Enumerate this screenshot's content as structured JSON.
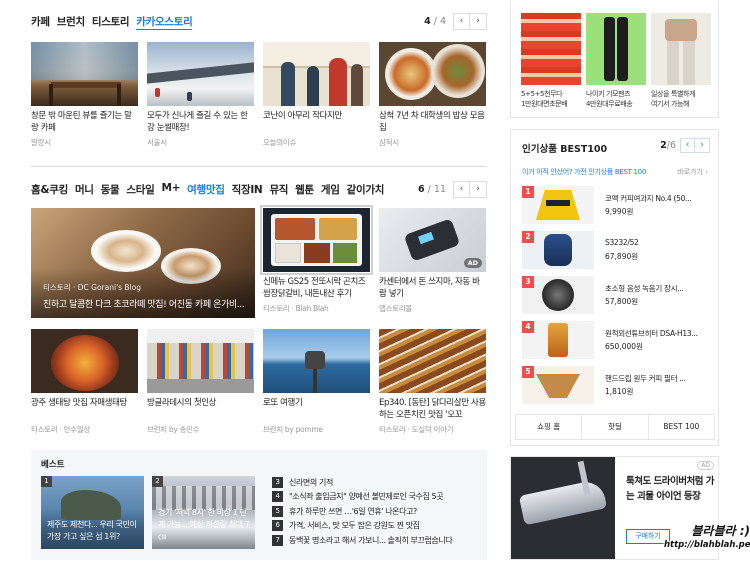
{
  "section1": {
    "tabs": [
      "카페",
      "브런치",
      "티스토리",
      "카카오스토리"
    ],
    "active_index": 3,
    "pager": {
      "current": "4",
      "total": "4"
    },
    "cards": [
      {
        "title": "창문 밖 마운틴 뷰를 즐기는 말랑 카페",
        "source": "말랑시"
      },
      {
        "title": "모두가 신나게 즐길 수 있는 한강 눈썰매장!",
        "source": "서울시"
      },
      {
        "title": "코난이 아무리 작다지만",
        "source": "오늘의이슈"
      },
      {
        "title": "삼척 7년 차 대학생의 밥상 모음집",
        "source": "삼척시"
      }
    ]
  },
  "section2": {
    "tabs": [
      "홈&쿠킹",
      "머니",
      "동물",
      "스타일",
      "M+",
      "여행맛집",
      "직장IN",
      "뮤직",
      "웹툰",
      "게임",
      "같이가치"
    ],
    "active_index": 5,
    "pager": {
      "current": "6",
      "total": "11"
    },
    "feature": {
      "source": "티스토리 · DC Gorani's Blog",
      "title": "진하고 달콤한 다크 초코라떼 맛집! 어진동 카페 온가비..."
    },
    "cards_top": [
      {
        "title": "신메뉴 GS25 전또시락 곤치즈 쌈장닭갈비, 내돈내산 후기",
        "source": "티스토리 · Blah Blah"
      },
      {
        "title": "카센터에서 돈 쓰지마, 자동 바람 넣기",
        "source": "앱스토리몰",
        "ad": "AD"
      }
    ],
    "cards_bottom": [
      {
        "title": "광주 생태탕 맛집 자매생태탕",
        "source": "티스토리 · 만수일상"
      },
      {
        "title": "방글라데시의 첫인상",
        "source": "브런치 by 송민수"
      },
      {
        "title": "로또 여행기",
        "source": "브런치 by pomme"
      },
      {
        "title": "Ep340. [동탄] 닭다리살만 사용하는 오픈치킨 맛집 '오꼬",
        "source": "티스토리 · 도실덕 이야기"
      }
    ]
  },
  "best": {
    "title": "베스트",
    "thumbs": [
      {
        "num": "1",
        "caption": "제주도 제천다... 우리 국민이 가장 가고 싶은 섬 1위?"
      },
      {
        "num": "2",
        "caption": "경기 '저녁 8시' 한 비상 1 단계 가능... 예상 적설량 최대 7㎝"
      }
    ],
    "items": [
      {
        "num": "3",
        "text": "신라면의 기적"
      },
      {
        "num": "4",
        "text": "\"소식좌 출입금지\" 양예선 볼만제로인 국수집 5곳"
      },
      {
        "num": "5",
        "text": "휴가 하루만 쓰면 …'6일 연휴' 나온다고?"
      },
      {
        "num": "6",
        "text": "가격, 서비스, 맛 모두 잡은 강원도 찐 맛집"
      },
      {
        "num": "7",
        "text": "동백꽃 명소라고 해서 가보니... 솔직히 부끄럽습니다"
      }
    ]
  },
  "shop_top": {
    "items": [
      {
        "line1": "5+5+5천무다",
        "line2": "1만원대면초문배"
      },
      {
        "line1": "나이키 기모팬츠",
        "line2": "4만원대무료배송"
      },
      {
        "line1": "일상을 특별하게",
        "line2": "여기서 가능해"
      }
    ]
  },
  "popular": {
    "title": "인기상품 BEST100",
    "pager": {
      "current": "2",
      "total": "6"
    },
    "subtitle": "이거 아직 안샀어? 가전 인기상품 BEST 100",
    "more": "바로가기 ›",
    "items": [
      {
        "num": "1",
        "name": "코맥 커피여과지 No.4 (50...",
        "price": "9,990원"
      },
      {
        "num": "2",
        "name": "S3232/52",
        "price": "67,890원"
      },
      {
        "num": "3",
        "name": "초소형 음성 녹음기 장시...",
        "price": "57,800원"
      },
      {
        "num": "4",
        "name": "원적외선튜브히터 DSA-H13...",
        "price": "650,000원"
      },
      {
        "num": "5",
        "name": "핸드드립 원두 커피 필터 ...",
        "price": "1,810원"
      }
    ],
    "footer": [
      "쇼핑 홈",
      "핫딜",
      "BEST 100"
    ]
  },
  "ad": {
    "tag": "AD",
    "title": "툭쳐도 드라이버처럼 가는 괴물 아이언 등장",
    "button": "구매하기"
  },
  "watermark": {
    "line1": "블라블라 :)",
    "line2": "http://blahblah.pe.kr"
  },
  "colors": {
    "accent": "#0f80e6",
    "rank_red": "#f04e4e"
  }
}
